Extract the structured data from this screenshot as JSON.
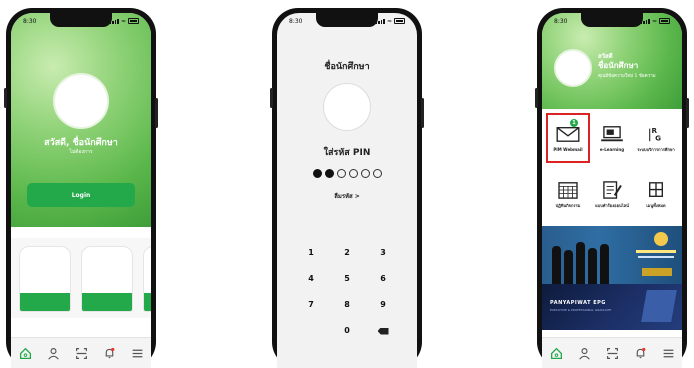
{
  "status_time": "8:30",
  "colors": {
    "brand_green": "#23a84a",
    "highlight_red": "#dd2222"
  },
  "phone1": {
    "greeting": "สวัสดี, ชื่อนักศึกษา",
    "subtitle": "ไม่ต้องการ",
    "login_label": "Login",
    "cards": [
      "card-1",
      "card-2",
      "card-3"
    ]
  },
  "phone2": {
    "title": "ชื่อนักศึกษา",
    "pin_label": "ใส่รหัส PIN",
    "pin_filled": 2,
    "pin_total": 6,
    "forgot_label": "ลืมรหัส >",
    "keys": [
      "1",
      "2",
      "3",
      "4",
      "5",
      "6",
      "7",
      "8",
      "9",
      "",
      "0",
      "delete"
    ]
  },
  "phone3": {
    "greeting": "สวัสดี",
    "name": "ชื่อนักศึกษา",
    "message": "คุณมีข้อความใหม่ 1 ข้อความ",
    "menu": [
      {
        "label": "PIM Webmail",
        "icon": "mail-icon",
        "badge": "1",
        "highlight": true
      },
      {
        "label": "e-Learning",
        "icon": "laptop-icon"
      },
      {
        "label": "ระบบบริการการศึกษา",
        "icon": "registration-icon"
      },
      {
        "label": "ปฏิทินกิจกรรม",
        "icon": "calendar-icon"
      },
      {
        "label": "แบบคำร้องออนไลน์",
        "icon": "form-icon"
      },
      {
        "label": "เมนูทั้งหมด",
        "icon": "grid-icon"
      }
    ],
    "banner2_title": "PANYAPIWAT EPG",
    "banner2_sub": "EXECUTIVE & PROFESSIONAL GRADUATE"
  },
  "tabs": [
    "home-icon",
    "profile-icon",
    "scan-icon",
    "notification-icon",
    "menu-icon"
  ]
}
